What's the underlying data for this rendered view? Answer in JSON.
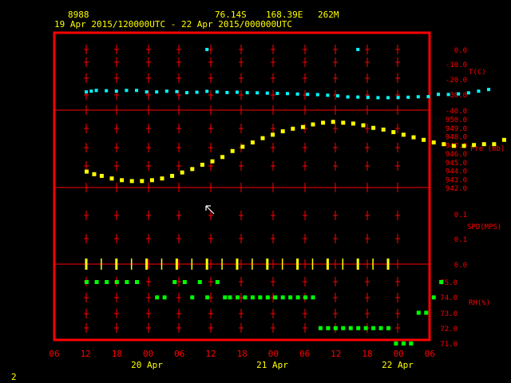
{
  "header": {
    "station_id": "8988",
    "latitude": "76.14S",
    "longitude": "168.39E",
    "elevation": "262M",
    "period": "19 Apr 2015/120000UTC - 22 Apr 2015/000000UTC"
  },
  "corner_label": "2",
  "colors": {
    "frame": "#ff0000",
    "temperature": "#00ffff",
    "pressure": "#ffff00",
    "wind": "#ffff00",
    "humidity": "#00ff00",
    "axis_text": "#ff0000",
    "time_text": "#ffff00"
  },
  "chart_data": {
    "type": "scatter",
    "x_axis": {
      "unit": "hours UTC",
      "range_hours": [
        -6,
        66
      ],
      "tick_labels": [
        "06",
        "12",
        "18",
        "00",
        "06",
        "12",
        "18",
        "00",
        "06",
        "12",
        "18",
        "00",
        "06"
      ],
      "day_labels": [
        "20 Apr",
        "21 Apr",
        "22 Apr"
      ]
    },
    "panels": [
      {
        "name": "T(C)",
        "ticks": [
          "0.0",
          "-10.0",
          "-20.0",
          "-30.0",
          "-40.0"
        ],
        "ylim": [
          -40,
          0
        ],
        "series": [
          {
            "x": 0,
            "y": -28
          },
          {
            "x": 1,
            "y": -27.5
          },
          {
            "x": 2,
            "y": -27
          },
          {
            "x": 4,
            "y": -27.2
          },
          {
            "x": 6,
            "y": -27.5
          },
          {
            "x": 8,
            "y": -27
          },
          {
            "x": 10,
            "y": -27
          },
          {
            "x": 12,
            "y": -28
          },
          {
            "x": 14,
            "y": -28
          },
          {
            "x": 16,
            "y": -27.5
          },
          {
            "x": 18,
            "y": -27.8
          },
          {
            "x": 20,
            "y": -28.5
          },
          {
            "x": 22,
            "y": -28.2
          },
          {
            "x": 24,
            "y": -27.6
          },
          {
            "x": 26,
            "y": -28
          },
          {
            "x": 28,
            "y": -28.4
          },
          {
            "x": 30,
            "y": -28.2
          },
          {
            "x": 32,
            "y": -28.5
          },
          {
            "x": 34,
            "y": -28.6
          },
          {
            "x": 36,
            "y": -28.8
          },
          {
            "x": 38,
            "y": -29
          },
          {
            "x": 40,
            "y": -29.1
          },
          {
            "x": 42,
            "y": -29.4
          },
          {
            "x": 44,
            "y": -29.6
          },
          {
            "x": 46,
            "y": -29.8
          },
          {
            "x": 48,
            "y": -30.2
          },
          {
            "x": 50,
            "y": -30.6
          },
          {
            "x": 52,
            "y": -31.3
          },
          {
            "x": 54,
            "y": -31.4
          },
          {
            "x": 56,
            "y": -31.6
          },
          {
            "x": 58,
            "y": -31.8
          },
          {
            "x": 60,
            "y": -31.8
          },
          {
            "x": 62,
            "y": -31.7
          },
          {
            "x": 64,
            "y": -31.5
          },
          {
            "x": 66,
            "y": -31.2
          },
          {
            "x": 68,
            "y": -31.1
          },
          {
            "x": 70,
            "y": -29.6
          },
          {
            "x": 72,
            "y": -29.7
          },
          {
            "x": 74,
            "y": -29.3
          },
          {
            "x": 76,
            "y": -28.6
          },
          {
            "x": 78,
            "y": -27.5
          },
          {
            "x": 80,
            "y": -26.4
          }
        ],
        "outliers": [
          {
            "x": 24,
            "y": 0
          },
          {
            "x": 54,
            "y": 0
          }
        ]
      },
      {
        "name": "Pre (mb)",
        "ticks": [
          "950.0",
          "949.0",
          "948.0",
          "947.0",
          "946.0",
          "945.0",
          "944.0",
          "943.0",
          "942.0"
        ],
        "ylim": [
          942,
          950
        ],
        "series": [
          {
            "x": 0,
            "y": 943.9
          },
          {
            "x": 1.5,
            "y": 943.6
          },
          {
            "x": 3,
            "y": 943.4
          },
          {
            "x": 5,
            "y": 943.1
          },
          {
            "x": 7,
            "y": 942.9
          },
          {
            "x": 9,
            "y": 942.8
          },
          {
            "x": 11,
            "y": 942.8
          },
          {
            "x": 13,
            "y": 942.9
          },
          {
            "x": 15,
            "y": 943.1
          },
          {
            "x": 17,
            "y": 943.4
          },
          {
            "x": 19,
            "y": 943.8
          },
          {
            "x": 21,
            "y": 944.2
          },
          {
            "x": 23,
            "y": 944.7
          },
          {
            "x": 25,
            "y": 945.1
          },
          {
            "x": 27,
            "y": 945.6
          },
          {
            "x": 29,
            "y": 946.3
          },
          {
            "x": 31,
            "y": 946.8
          },
          {
            "x": 33,
            "y": 947.3
          },
          {
            "x": 35,
            "y": 947.8
          },
          {
            "x": 37,
            "y": 948.2
          },
          {
            "x": 39,
            "y": 948.6
          },
          {
            "x": 41,
            "y": 948.9
          },
          {
            "x": 43,
            "y": 949.1
          },
          {
            "x": 45,
            "y": 949.4
          },
          {
            "x": 47,
            "y": 949.6
          },
          {
            "x": 49,
            "y": 949.7
          },
          {
            "x": 51,
            "y": 949.6
          },
          {
            "x": 53,
            "y": 949.5
          },
          {
            "x": 55,
            "y": 949.3
          },
          {
            "x": 57,
            "y": 949.0
          },
          {
            "x": 59,
            "y": 948.8
          },
          {
            "x": 61,
            "y": 948.5
          },
          {
            "x": 63,
            "y": 948.2
          },
          {
            "x": 65,
            "y": 947.9
          },
          {
            "x": 67,
            "y": 947.6
          },
          {
            "x": 69,
            "y": 947.3
          },
          {
            "x": 71,
            "y": 947.1
          },
          {
            "x": 73,
            "y": 946.9
          },
          {
            "x": 75,
            "y": 946.9
          },
          {
            "x": 77,
            "y": 947.0
          },
          {
            "x": 79,
            "y": 947.1
          },
          {
            "x": 81,
            "y": 947.1
          },
          {
            "x": 83,
            "y": 947.6
          },
          {
            "x": 85,
            "y": 948.0
          }
        ]
      },
      {
        "name": "SPD(MPS)",
        "ticks": [
          "0.1",
          "0.1",
          "0.0"
        ],
        "wind_barb_times": [
          0,
          3,
          6,
          9,
          12,
          15,
          18,
          21,
          24,
          27,
          30,
          33,
          36,
          39,
          42,
          45,
          48,
          51,
          54,
          57,
          60
        ]
      },
      {
        "name": "RH(%)",
        "ticks": [
          "75.0",
          "74.0",
          "73.0",
          "72.0",
          "71.0"
        ],
        "ylim": [
          71,
          75
        ],
        "series": [
          {
            "x": 0,
            "y": 75
          },
          {
            "x": 2,
            "y": 75
          },
          {
            "x": 4,
            "y": 75
          },
          {
            "x": 6,
            "y": 75
          },
          {
            "x": 8,
            "y": 75
          },
          {
            "x": 10,
            "y": 75
          },
          {
            "x": 14,
            "y": 74
          },
          {
            "x": 15.5,
            "y": 74
          },
          {
            "x": 17.5,
            "y": 75
          },
          {
            "x": 19.5,
            "y": 75
          },
          {
            "x": 21,
            "y": 74
          },
          {
            "x": 22.5,
            "y": 75
          },
          {
            "x": 24,
            "y": 74
          },
          {
            "x": 26,
            "y": 75
          },
          {
            "x": 27.5,
            "y": 74
          },
          {
            "x": 28.5,
            "y": 74
          },
          {
            "x": 30,
            "y": 74
          },
          {
            "x": 31.5,
            "y": 74
          },
          {
            "x": 33,
            "y": 74
          },
          {
            "x": 34.5,
            "y": 74
          },
          {
            "x": 36,
            "y": 74
          },
          {
            "x": 37.5,
            "y": 74
          },
          {
            "x": 39,
            "y": 74
          },
          {
            "x": 40.5,
            "y": 74
          },
          {
            "x": 42,
            "y": 74
          },
          {
            "x": 43.5,
            "y": 74
          },
          {
            "x": 45,
            "y": 74
          },
          {
            "x": 46.5,
            "y": 72
          },
          {
            "x": 48,
            "y": 72
          },
          {
            "x": 49.5,
            "y": 72
          },
          {
            "x": 51,
            "y": 72
          },
          {
            "x": 52.5,
            "y": 72
          },
          {
            "x": 54,
            "y": 72
          },
          {
            "x": 55.5,
            "y": 72
          },
          {
            "x": 57,
            "y": 72
          },
          {
            "x": 58.5,
            "y": 72
          },
          {
            "x": 60,
            "y": 72
          },
          {
            "x": 61.5,
            "y": 71
          },
          {
            "x": 63,
            "y": 71
          },
          {
            "x": 64.5,
            "y": 71
          },
          {
            "x": 66,
            "y": 73
          },
          {
            "x": 67.5,
            "y": 73
          },
          {
            "x": 69,
            "y": 74
          },
          {
            "x": 70.5,
            "y": 75
          }
        ]
      }
    ]
  }
}
